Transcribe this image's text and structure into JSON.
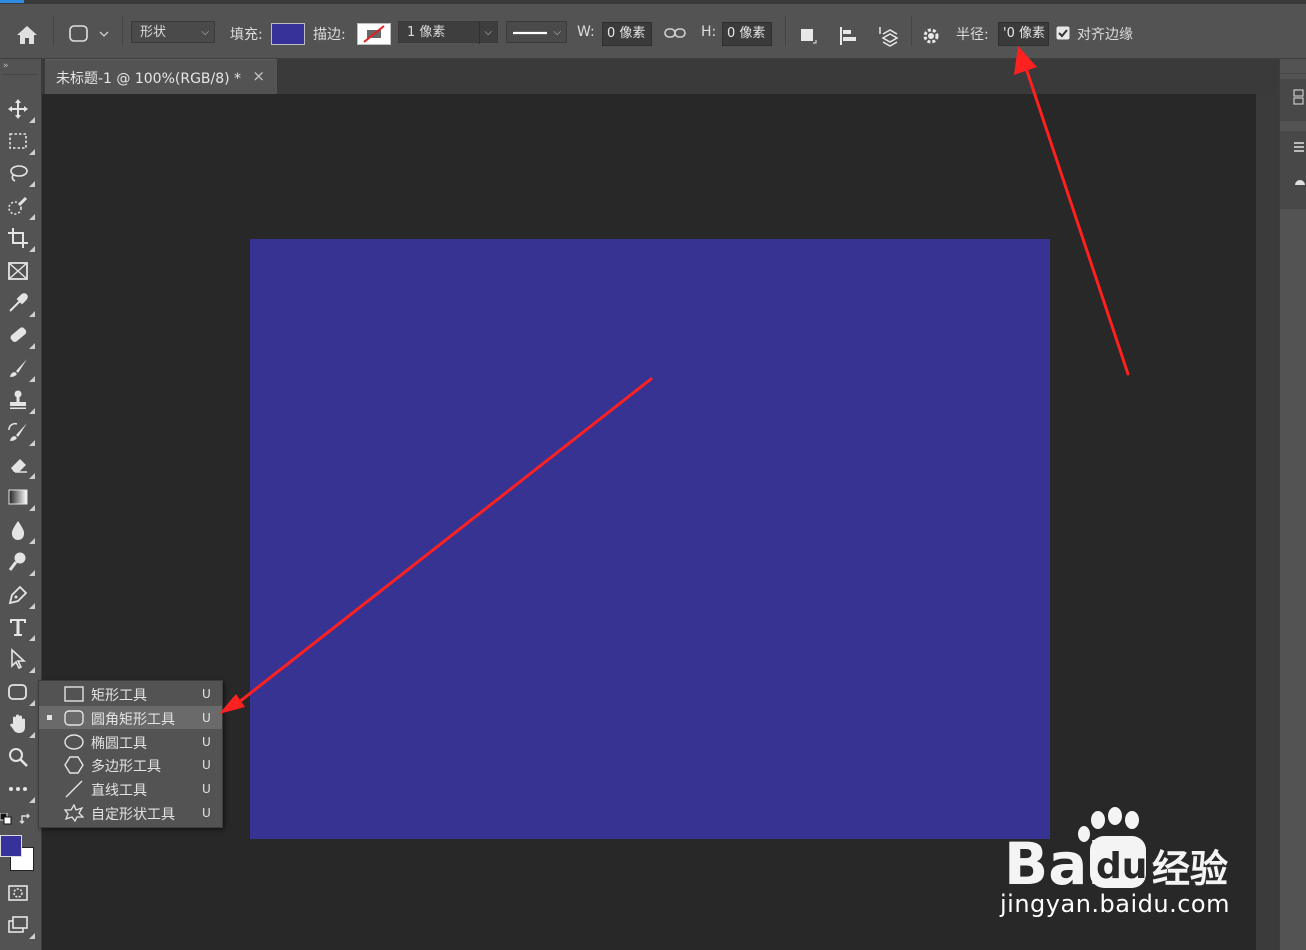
{
  "options_bar": {
    "mode_label": "形状",
    "fill_label": "填充:",
    "fill_color": "#36329a",
    "stroke_label": "描边:",
    "stroke_width": "1 像素",
    "w_label": "W:",
    "w_value": "0 像素",
    "h_label": "H:",
    "h_value": "0 像素",
    "radius_label": "半径:",
    "radius_value": "'0 像素",
    "align_edges_label": "对齐边缘",
    "align_edges_checked": true
  },
  "document_tab": {
    "title": "未标题-1 @ 100%(RGB/8) *",
    "close_glyph": "×"
  },
  "canvas": {
    "fill_color": "#373393"
  },
  "toolbar": {
    "tools": [
      "move-icon",
      "marquee-icon",
      "lasso-icon",
      "quick-select-icon",
      "crop-icon",
      "frame-icon",
      "eyedropper-icon",
      "healing-icon",
      "brush-icon",
      "stamp-icon",
      "history-brush-icon",
      "eraser-icon",
      "gradient-icon",
      "blur-icon",
      "dodge-icon",
      "pen-icon",
      "type-icon",
      "path-select-icon",
      "rounded-rect-icon",
      "hand-icon",
      "zoom-icon",
      "more-icon"
    ],
    "foreground_color": "#36329a",
    "background_color": "#ffffff"
  },
  "shape_flyout": {
    "items": [
      {
        "label": "矩形工具",
        "key": "U",
        "icon": "rectangle-icon",
        "selected": false
      },
      {
        "label": "圆角矩形工具",
        "key": "U",
        "icon": "rounded-rectangle-icon",
        "selected": true
      },
      {
        "label": "椭圆工具",
        "key": "U",
        "icon": "ellipse-icon",
        "selected": false
      },
      {
        "label": "多边形工具",
        "key": "U",
        "icon": "polygon-icon",
        "selected": false
      },
      {
        "label": "直线工具",
        "key": "U",
        "icon": "line-icon",
        "selected": false
      },
      {
        "label": "自定形状工具",
        "key": "U",
        "icon": "custom-shape-icon",
        "selected": false
      }
    ]
  },
  "annotation": {
    "arrow_color": "#ff2020"
  },
  "watermark": {
    "brand": "Bai du 经验",
    "url": "jingyan.baidu.com"
  }
}
